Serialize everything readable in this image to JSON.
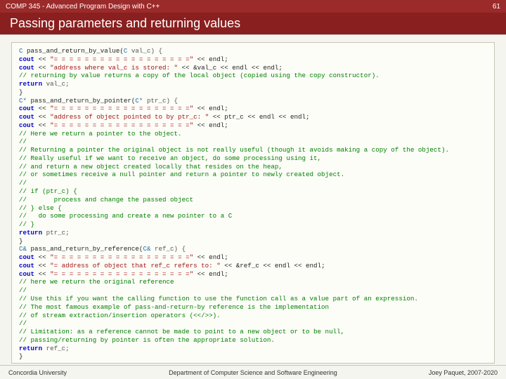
{
  "topbar": {
    "course": "COMP 345 - Advanced Program Design with C++",
    "page_num": "61"
  },
  "title": "Passing parameters and returning values",
  "code": {
    "l01_t": "C",
    "l01_r": " pass_and_return_by_value(",
    "l01_t2": "C",
    "l01_r2": " val_c) {",
    "l02_a": "cout",
    "l02_b": " << ",
    "l02_s": "\"= = = = = = = = = = = = = = = = = =\"",
    "l02_c": " << endl;",
    "l03_a": "cout",
    "l03_b": " << ",
    "l03_s": "\"address where val_c is stored: \"",
    "l03_c": " << &val_c << endl << endl;",
    "l04": "// returning by value returns a copy of the local object (copied using the copy constructor).",
    "l05_a": "return",
    "l05_b": " val_c;",
    "l06": "}",
    "l07_t": "C*",
    "l07_r": " pass_and_return_by_pointer(",
    "l07_t2": "C*",
    "l07_r2": " ptr_c) {",
    "l08_a": "cout",
    "l08_b": " << ",
    "l08_s": "\"= = = = = = = = = = = = = = = = = =\"",
    "l08_c": " << endl;",
    "l09_a": "cout",
    "l09_b": " << ",
    "l09_s": "\"address of object pointed to by ptr_c: \"",
    "l09_c": " << ptr_c << endl << endl;",
    "l10_a": "cout",
    "l10_b": " << ",
    "l10_s": "\"= = = = = = = = = = = = = = = = = =\"",
    "l10_c": " << endl;",
    "l11": "// Here we return a pointer to the object.",
    "l12": "//",
    "l13": "// Returning a pointer the original object is not really useful (though it avoids making a copy of the object).",
    "l14": "// Really useful if we want to receive an object, do some processing using it,",
    "l15": "// and return a new object created locally that resides on the heap,",
    "l16": "// or sometimes receive a null pointer and return a pointer to newly created object.",
    "l17": "//",
    "l18": "// if (ptr_c) {",
    "l19": "//       process and change the passed object",
    "l20": "// } else {",
    "l21": "//   do some processing and create a new pointer to a C",
    "l22": "// }",
    "l23_a": "return",
    "l23_b": " ptr_c;",
    "l24": "}",
    "l25_t": "C&",
    "l25_r": " pass_and_return_by_reference(",
    "l25_t2": "C&",
    "l25_r2": " ref_c) {",
    "l26_a": "cout",
    "l26_b": " << ",
    "l26_s": "\"= = = = = = = = = = = = = = = = = =\"",
    "l26_c": " << endl;",
    "l27_a": "cout",
    "l27_b": " << ",
    "l27_s": "\"= address of object that ref_c refers to: \"",
    "l27_c": " << &ref_c << endl << endl;",
    "l28_a": "cout",
    "l28_b": " << ",
    "l28_s": "\"= = = = = = = = = = = = = = = = = =\"",
    "l28_c": " << endl;",
    "l29": "// here we return the original reference",
    "l30": "//",
    "l31": "// Use this if you want the calling function to use the function call as a value part of an expression.",
    "l32": "// The most famous example of pass-and-return-by reference is the implementation",
    "l33": "// of stream extraction/insertion operators (<</>>).",
    "l34": "//",
    "l35": "// Limitation: as a reference cannot be made to point to a new object or to be null,",
    "l36": "// passing/returning by pointer is often the appropriate solution.",
    "l37_a": "return",
    "l37_b": " ref_c;",
    "l38": "}"
  },
  "footer": {
    "left": "Concordia University",
    "center": "Department of Computer Science and Software Engineering",
    "right": "Joey Paquet, 2007-2020"
  }
}
